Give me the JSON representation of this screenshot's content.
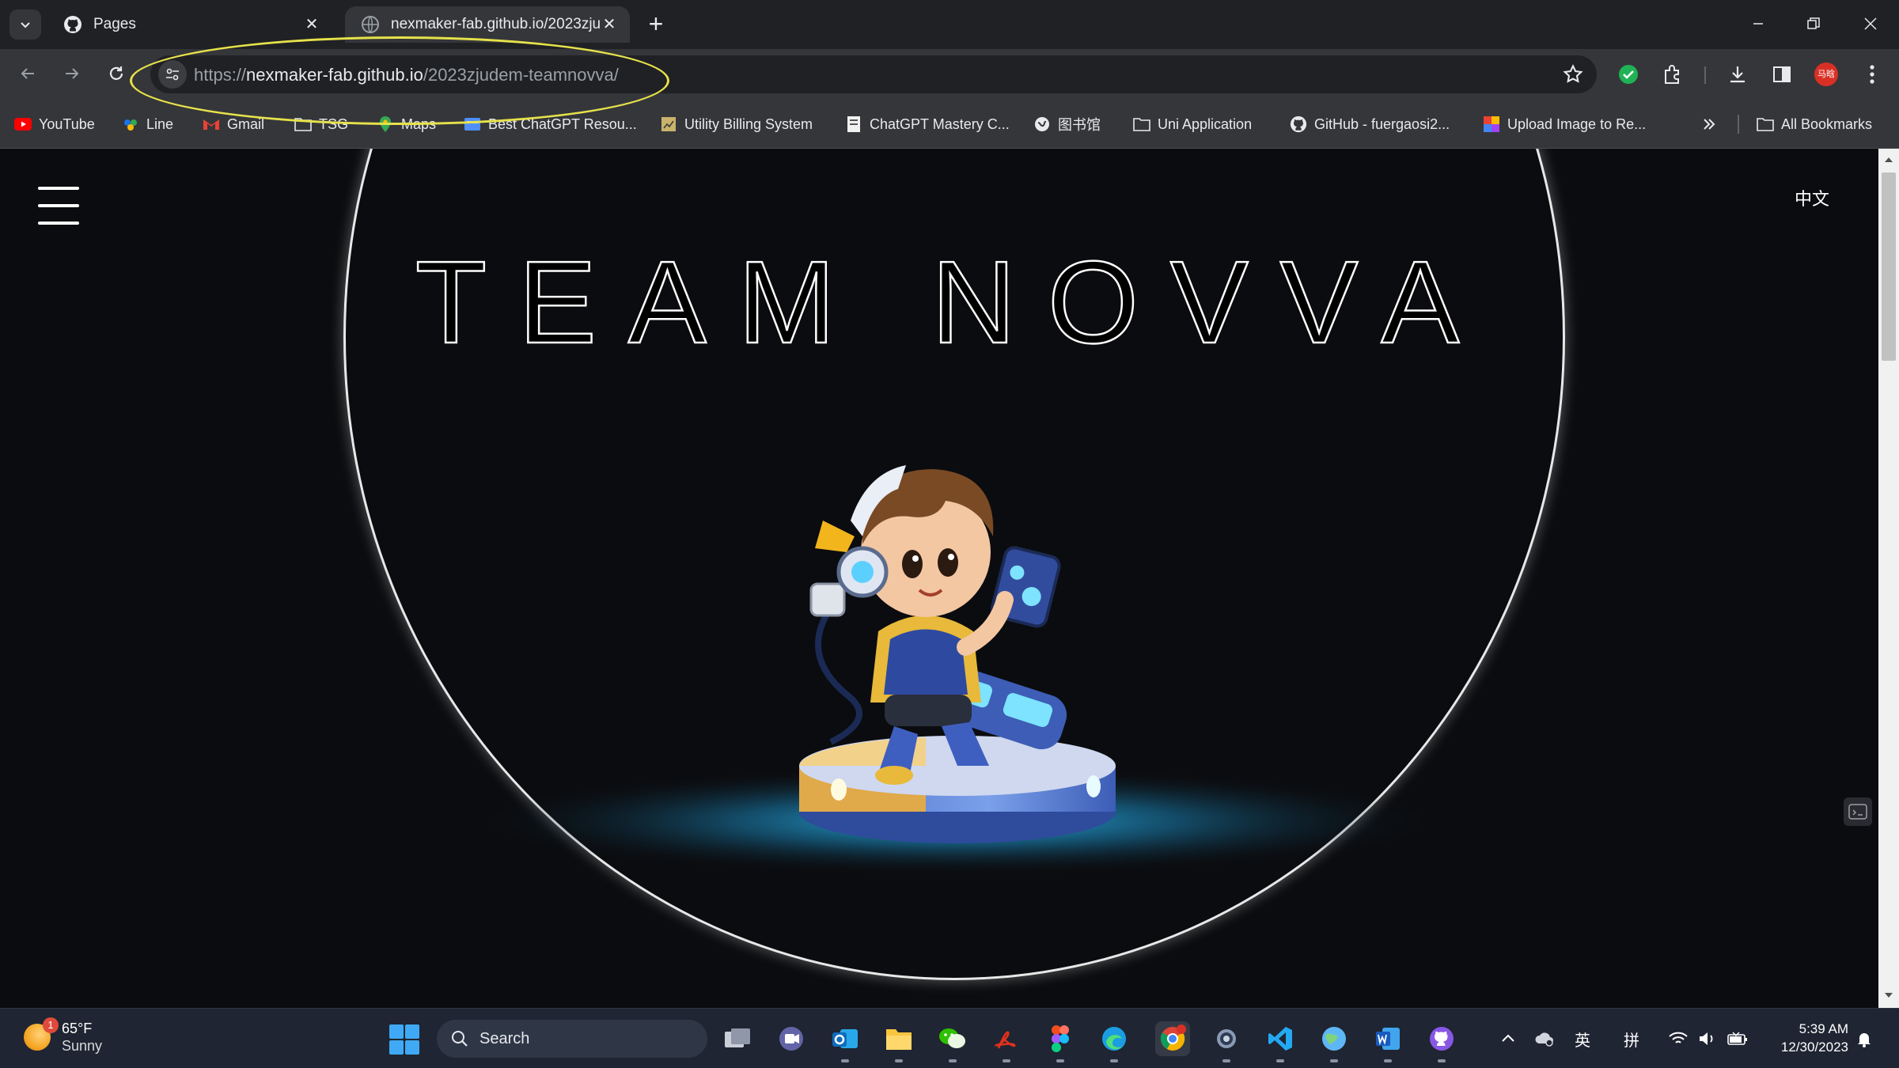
{
  "browser": {
    "tabs": [
      {
        "title": "Pages",
        "favicon": "github-icon",
        "active": false
      },
      {
        "title": "nexmaker-fab.github.io/2023zju",
        "favicon": "globe-icon",
        "active": true
      }
    ],
    "url": {
      "scheme": "https://",
      "host": "nexmaker-fab.github.io",
      "path": "/2023zjudem-teamnovva/"
    },
    "annotation_color": "#e6e24a",
    "profile_initials": "马晗",
    "bookmarks": [
      {
        "label": "YouTube",
        "icon": "youtube-icon"
      },
      {
        "label": "Line",
        "icon": "line-icon"
      },
      {
        "label": "Gmail",
        "icon": "gmail-icon"
      },
      {
        "label": "TSG",
        "icon": "folder-icon"
      },
      {
        "label": "Maps",
        "icon": "maps-icon"
      },
      {
        "label": "Best ChatGPT Resou...",
        "icon": "page-icon"
      },
      {
        "label": "Utility Billing System",
        "icon": "page-icon"
      },
      {
        "label": "ChatGPT Mastery C...",
        "icon": "page-icon"
      },
      {
        "label": "图书馆",
        "icon": "globe-icon"
      },
      {
        "label": "Uni Application",
        "icon": "folder-icon"
      },
      {
        "label": "GitHub - fuergaosi2...",
        "icon": "github-icon"
      },
      {
        "label": "Upload Image to Re...",
        "icon": "image-icon"
      }
    ],
    "all_bookmarks": "All Bookmarks"
  },
  "page": {
    "language_toggle": "中文",
    "hero_title": "TEAM NOVVA",
    "accent_glow": "#2ec4ff"
  },
  "taskbar": {
    "weather": {
      "temperature": "65°F",
      "condition": "Sunny",
      "badge": "1"
    },
    "search_label": "Search",
    "ime_lang": "英",
    "ime_mode": "拼",
    "time": "5:39 AM",
    "date": "12/30/2023"
  }
}
